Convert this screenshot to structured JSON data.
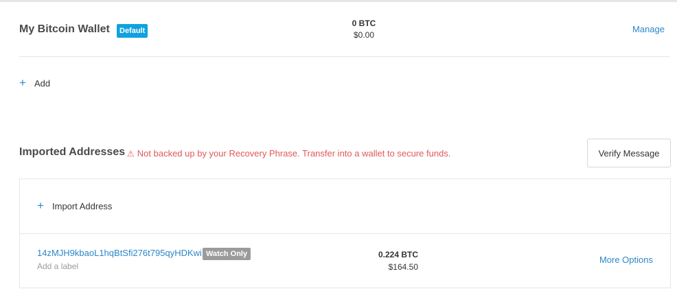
{
  "wallet": {
    "name": "My Bitcoin Wallet",
    "badge": "Default",
    "balance_btc": "0 BTC",
    "balance_usd": "$0.00",
    "manage_label": "Manage"
  },
  "add": {
    "label": "Add"
  },
  "imported": {
    "title": "Imported Addresses",
    "warning_icon": "⚠",
    "warning_text": "Not backed up by your Recovery Phrase. Transfer into a wallet to secure funds.",
    "verify_label": "Verify Message",
    "import_label": "Import Address",
    "addresses": [
      {
        "address": "14zMJH9kbaoL1hqBtSfi276t795qyHDKwi",
        "badge": "Watch Only",
        "label_placeholder": "Add a label",
        "balance_btc": "0.224 BTC",
        "balance_usd": "$164.50",
        "more_label": "More Options"
      }
    ]
  },
  "colors": {
    "accent": "#2b87c8",
    "default_badge": "#10a2df",
    "warning": "#e0585a",
    "watch_badge": "#9b9b9b"
  },
  "icons": {
    "plus": "plus-icon",
    "warning": "warning-icon"
  }
}
